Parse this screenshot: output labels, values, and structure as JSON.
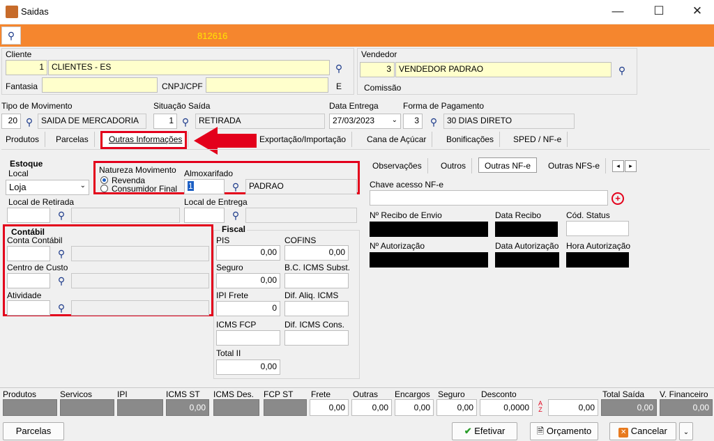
{
  "window": {
    "title": "Saidas",
    "minimize": "—",
    "maximize": "☐",
    "close": "✕"
  },
  "header": {
    "number": "812616"
  },
  "cliente": {
    "label": "Cliente",
    "code": "1",
    "name": "CLIENTES - ES",
    "fantasia_label": "Fantasia",
    "cnpj_label": "CNPJ/CPF",
    "e_label": "E"
  },
  "vendedor": {
    "label": "Vendedor",
    "code": "3",
    "name": "VENDEDOR PADRAO",
    "comissao_label": "Comissão"
  },
  "movimento": {
    "tipo_label": "Tipo  de Movimento",
    "tipo_code": "20",
    "tipo_name": "SAIDA DE MERCADORIA",
    "situacao_label": "Situação Saída",
    "situacao_code": "1",
    "situacao_name": "RETIRADA",
    "data_label": "Data Entrega",
    "data_value": "27/03/2023",
    "forma_label": "Forma de Pagamento",
    "forma_code": "3",
    "forma_name": "30 DIAS DIRETO"
  },
  "tabs": [
    "Produtos",
    "Parcelas",
    "Outras Informações",
    "Exportação/Importação",
    "Cana de Açúcar",
    "Bonificações",
    "SPED / NF-e"
  ],
  "estoque": {
    "title": "Estoque",
    "local_label": "Local",
    "local_value": "Loja",
    "natureza_label": "Natureza Movimento",
    "revenda": "Revenda",
    "consumidor": "Consumidor Final",
    "almox_label": "Almoxarifado",
    "almox_code": "1",
    "almox_name": "PADRAO",
    "retirada_label": "Local de Retirada",
    "entrega_label": "Local de Entrega"
  },
  "contabil": {
    "title": "Contábil",
    "conta_label": "Conta Contábil",
    "centro_label": "Centro de Custo",
    "atividade_label": "Atividade"
  },
  "fiscal": {
    "title": "Fiscal",
    "pis_label": "PIS",
    "pis": "0,00",
    "cofins_label": "COFINS",
    "cofins": "0,00",
    "seguro_label": "Seguro",
    "seguro": "0,00",
    "bc_label": "B.C. ICMS Subst.",
    "ipi_label": "IPI Frete",
    "ipi": "0",
    "dif_aliq_label": "Dif. Aliq. ICMS",
    "fcp_label": "ICMS FCP",
    "dif_cons_label": "Dif. ICMS Cons.",
    "total_ii_label": "Total II",
    "total_ii": "0,00"
  },
  "nfe_tabs": [
    "Observações",
    "Outros",
    "Outras NF-e",
    "Outras NFS-e"
  ],
  "nfe": {
    "chave_label": "Chave acesso NF-e",
    "recibo_label": "Nº Recibo de Envio",
    "data_recibo_label": "Data Recibo",
    "status_label": "Cód. Status",
    "autorizacao_label": "Nº Autorização",
    "data_aut_label": "Data Autorização",
    "hora_aut_label": "Hora Autorização"
  },
  "totals": {
    "labels": [
      "Produtos",
      "Servicos",
      "IPI",
      "ICMS ST",
      "ICMS Des.",
      "FCP ST",
      "Frete",
      "Outras",
      "Encargos",
      "Seguro",
      "Desconto",
      "Total Saída",
      "V. Financeiro"
    ],
    "icms_st": "0,00",
    "frete": "0,00",
    "outras": "0,00",
    "encargos": "0,00",
    "seguro": "0,00",
    "desconto": "0,0000",
    "desconto2": "0,00",
    "total_saida": "0,00",
    "v_financeiro": "0,00"
  },
  "buttons": {
    "parcelas": "Parcelas",
    "efetivar": "Efetivar",
    "orcamento": "Orçamento",
    "cancelar": "Cancelar"
  },
  "colors": {
    "orange": "#f5862e",
    "highlight_red": "#e3001b",
    "number_yellow": "#ffe600"
  }
}
